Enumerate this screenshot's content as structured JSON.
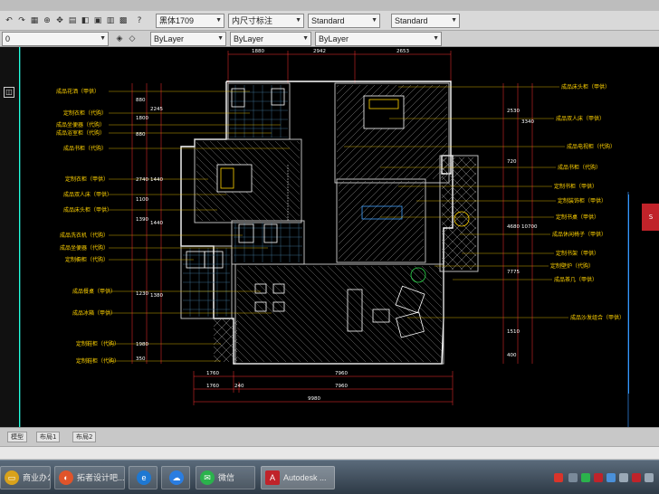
{
  "toolbar": {
    "text_style_font": "黑体1709",
    "dim_style": "内尺寸标注",
    "table_style": "Standard",
    "multileader_style": "Standard",
    "layer_color": "ByLayer",
    "layer_linetype": "ByLayer",
    "layer_lineweight": "ByLayer",
    "left_value": "0"
  },
  "plan": {
    "top_dims": [
      "1880",
      "2942",
      "2653"
    ],
    "bottom_dims_row1": [
      "1760",
      "7960"
    ],
    "bottom_dims_row2": [
      "1760",
      "240",
      "7960"
    ],
    "bottom_total": "9980",
    "left_dims": [
      "880",
      "1800",
      "2245",
      "880",
      "2740",
      "1440",
      "1100",
      "1390",
      "1440",
      "1230",
      "1380",
      "1980",
      "350"
    ],
    "right_dims": [
      "2530",
      "3340",
      "720",
      "4680",
      "10700",
      "7775",
      "1510",
      "400"
    ],
    "left_labels": [
      "成品花洒（甲供）",
      "定制衣柜（代购）",
      "成品坐便器（代购）",
      "成品浴室柜（代购）",
      "成品书柜（代购）",
      "定制衣柜（甲供）",
      "成品双人床（甲供）",
      "成品床头柜（甲供）",
      "成品洗衣机（代购）",
      "成品坐便器（代购）",
      "定制橱柜（代购）",
      "成品餐桌（甲供）",
      "成品冰箱（甲供）",
      "定制鞋柜（代购）",
      "定制鞋柜（代购）"
    ],
    "right_labels": [
      "成品床头柜（甲供）",
      "成品双人床（甲供）",
      "成品电视柜（代购）",
      "成品书柜（代购）",
      "定制书柜（甲供）",
      "定制装饰柜（甲供）",
      "定制书桌（甲供）",
      "成品休闲椅子（甲供）",
      "定制书架（甲供）",
      "定制壁炉（代购）",
      "成品茶几（甲供）",
      "成品沙发组合（甲供）"
    ]
  },
  "statusbar": {
    "tabs": [
      "模型",
      "布局1",
      "布局2"
    ]
  },
  "taskbar": {
    "items": [
      {
        "label": "商业办公 ...",
        "icon": "folder-icon",
        "color": "#d9a21b"
      },
      {
        "label": "拓者设计吧...",
        "icon": "browser-icon",
        "color": "#e0542a"
      },
      {
        "label": "",
        "icon": "ie-icon",
        "color": "#1e78d2"
      },
      {
        "label": "",
        "icon": "baidu-cloud-icon",
        "color": "#2a7de1"
      },
      {
        "label": "微信",
        "icon": "wechat-icon",
        "color": "#2bb24c"
      },
      {
        "label": "Autodesk ...",
        "icon": "autocad-icon",
        "color": "#c0232a"
      }
    ]
  },
  "colors": {
    "background": "#000000",
    "wall": "#ffffff",
    "label": "#ffd200",
    "leader": "#ff3030",
    "dim": "#ffffff",
    "grid": "#2fd9c8"
  }
}
